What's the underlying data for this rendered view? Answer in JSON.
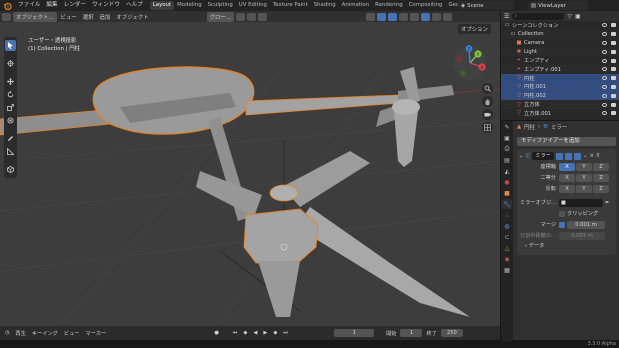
{
  "topbar": {
    "menus": [
      "ファイル",
      "編集",
      "レンダー",
      "ウィンドウ",
      "ヘルプ"
    ],
    "workspaces": [
      "Layout",
      "Modeling",
      "Sculpting",
      "UV Editing",
      "Texture Paint",
      "Shading",
      "Animation",
      "Rendering",
      "Compositing",
      "Geometry Nodes"
    ],
    "active_workspace": "Layout",
    "scene": "Scene",
    "view_layer": "ViewLayer"
  },
  "viewport": {
    "mode": "オブジェクト...",
    "header_menus": [
      "ビュー",
      "選択",
      "追加",
      "オブジェクト"
    ],
    "transform_orientation": "グロー...",
    "options": "オプション",
    "info_line1": "ユーザー・透視投影",
    "info_line2": "(1) Collection | 円柱",
    "gizmo": {
      "x": "X",
      "y": "Y",
      "z": "Z"
    }
  },
  "timeline": {
    "menus": [
      "再生",
      "キーイング",
      "ビュー",
      "マーカー"
    ],
    "current_frame": "1",
    "start_label": "開始",
    "start": "1",
    "end_label": "終了",
    "end": "250"
  },
  "status": {
    "version": "3.3.0 Alpha"
  },
  "outliner": {
    "search_placeholder": "",
    "items": [
      {
        "label": "シーンコレクション",
        "indent": 0,
        "icon": "scene-collection-icon",
        "color": "#cfcfcf",
        "selected": false
      },
      {
        "label": "Collection",
        "indent": 1,
        "icon": "collection-icon",
        "color": "#cfcfcf",
        "selected": false
      },
      {
        "label": "Camera",
        "indent": 2,
        "icon": "camera-icon",
        "color": "#e0774b",
        "selected": false
      },
      {
        "label": "Light",
        "indent": 2,
        "icon": "light-icon",
        "color": "#e0774b",
        "selected": false
      },
      {
        "label": "エンプティ",
        "indent": 2,
        "icon": "empty-icon",
        "color": "#e0774b",
        "selected": false
      },
      {
        "label": "エンプティ.001",
        "indent": 2,
        "icon": "empty-icon",
        "color": "#e0774b",
        "selected": false
      },
      {
        "label": "円柱",
        "indent": 2,
        "icon": "mesh-icon",
        "color": "#e0774b",
        "selected": true
      },
      {
        "label": "円柱.001",
        "indent": 2,
        "icon": "mesh-icon",
        "color": "#e0774b",
        "selected": true
      },
      {
        "label": "円柱.002",
        "indent": 2,
        "icon": "mesh-icon",
        "color": "#e0774b",
        "selected": true
      },
      {
        "label": "立方体",
        "indent": 2,
        "icon": "mesh-icon",
        "color": "#e0774b",
        "selected": false
      },
      {
        "label": "立方体.001",
        "indent": 2,
        "icon": "mesh-icon",
        "color": "#e0774b",
        "selected": false
      }
    ]
  },
  "properties": {
    "breadcrumb_object": "円柱",
    "breadcrumb_modifier": "ミラー",
    "add_modifier": "モディファイアーを追加",
    "modifier": {
      "name": "ミラー",
      "axis_label": "座標軸",
      "bisect_label": "二等分",
      "flip_label": "反転",
      "axis_x": "X",
      "axis_y": "Y",
      "axis_z": "Z",
      "mirror_object_label": "ミラーオブジ...",
      "clipping_label": "クリッピング",
      "merge_label": "マージ",
      "merge_value": "0.001 m",
      "bisect_distance_label": "分割中距離の...",
      "bisect_distance_value": "0.001 m",
      "data_label": "データ"
    }
  }
}
